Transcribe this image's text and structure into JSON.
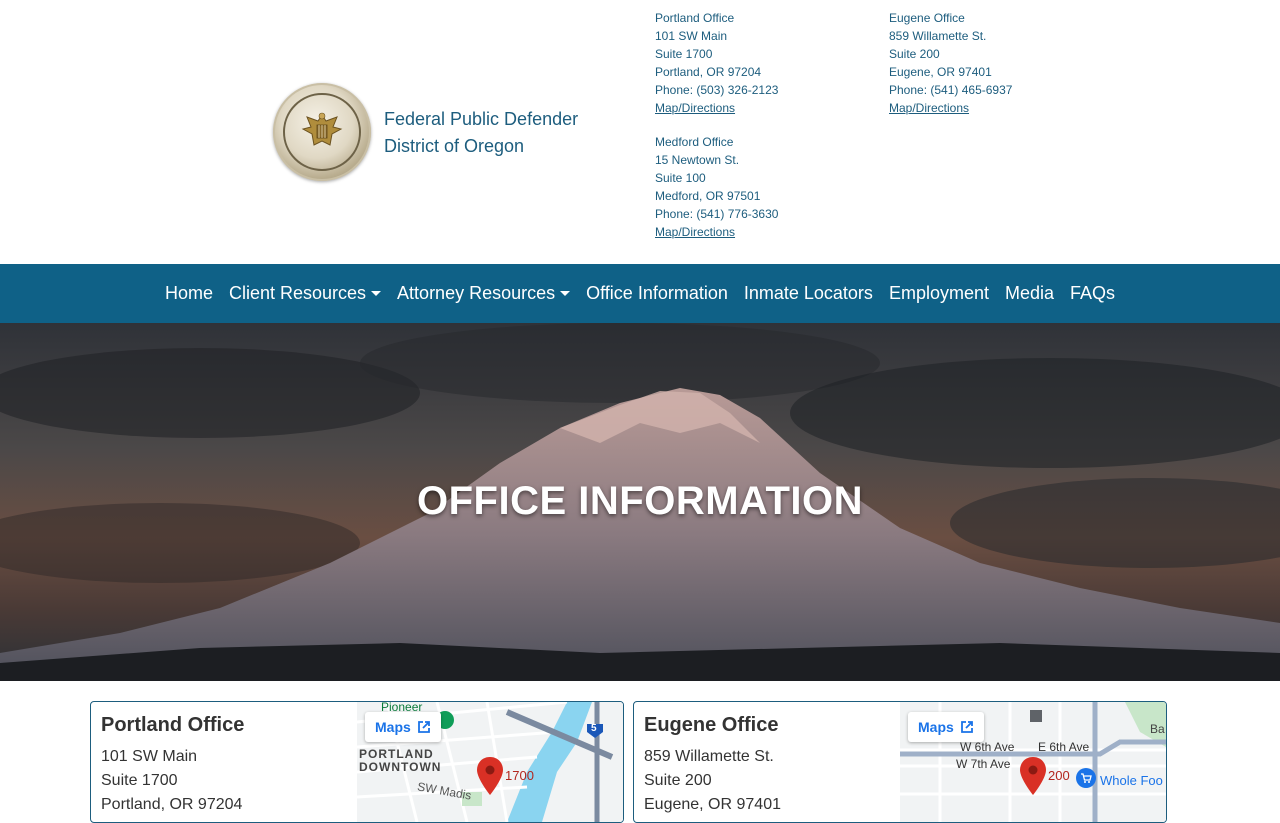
{
  "header": {
    "name_line1": "Federal Public Defender",
    "name_line2": "District of Oregon",
    "offices": [
      {
        "name": "Portland Office",
        "street": "101 SW Main",
        "suite": "Suite 1700",
        "city": "Portland, OR 97204",
        "phone": "Phone: (503) 326-2123",
        "link": "Map/Directions"
      },
      {
        "name": "Eugene Office",
        "street": "859 Willamette St.",
        "suite": "Suite 200",
        "city": "Eugene, OR 97401",
        "phone": "Phone: (541) 465-6937",
        "link": "Map/Directions"
      },
      {
        "name": "Medford Office",
        "street": "15 Newtown St.",
        "suite": "Suite 100",
        "city": "Medford, OR 97501",
        "phone": "Phone: (541) 776-3630",
        "link": "Map/Directions"
      }
    ]
  },
  "nav": {
    "items": [
      "Home",
      "Client Resources",
      "Attorney Resources",
      "Office Information",
      "Inmate Locators",
      "Employment",
      "Media",
      "FAQs"
    ]
  },
  "hero": {
    "title": "OFFICE INFORMATION"
  },
  "cards": [
    {
      "title": "Portland Office",
      "street": "101 SW Main",
      "suite": "Suite 1700",
      "city": "Portland, OR 97204",
      "map": {
        "button": "Maps",
        "label1": "Pioneer",
        "label2": "PORTLAND",
        "label3": "DOWNTOWN",
        "label4": "SW Madis",
        "pin_label": "1700",
        "shield": "5"
      }
    },
    {
      "title": "Eugene Office",
      "street": "859 Willamette St.",
      "suite": "Suite 200",
      "city": "Eugene, OR 97401",
      "map": {
        "button": "Maps",
        "label1": "W 6th Ave",
        "label2": "E 6th Ave",
        "label3": "W 7th Ave",
        "label4": "Whole Foo",
        "pin_label": "200",
        "label5": "Ba"
      }
    }
  ],
  "colors": {
    "primary": "#0f6187",
    "link": "#1d5d7e",
    "pin": "#d93025",
    "maps_blue": "#1a73e8"
  }
}
